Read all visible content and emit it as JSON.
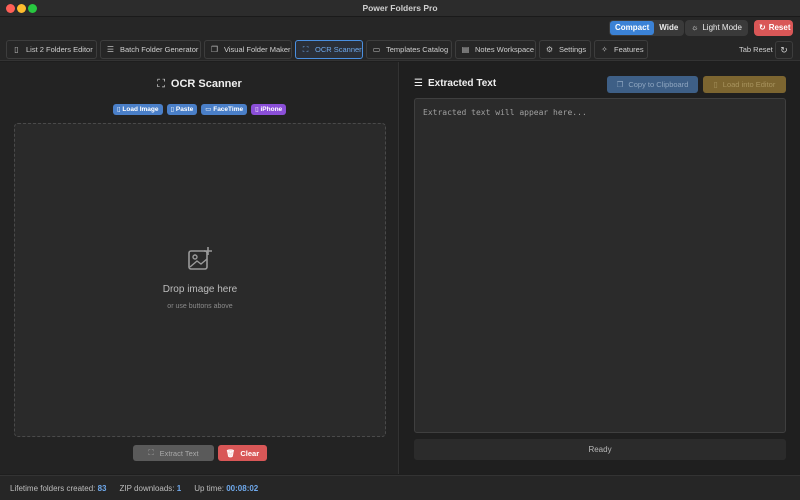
{
  "window": {
    "title": "Power Folders Pro"
  },
  "toolbar": {
    "compact_label": "Compact",
    "wide_label": "Wide",
    "light_mode_label": "Light Mode",
    "reset_label": "Reset"
  },
  "tabs": [
    {
      "label": "List 2 Folders Editor",
      "icon": "clipboard-icon"
    },
    {
      "label": "Batch Folder Generator",
      "icon": "list-icon"
    },
    {
      "label": "Visual Folder Maker",
      "icon": "image-stack-icon"
    },
    {
      "label": "OCR Scanner",
      "icon": "scan-icon",
      "active": true
    },
    {
      "label": "Templates Catalog",
      "icon": "folder-icon"
    },
    {
      "label": "Notes Workspace",
      "icon": "note-icon"
    },
    {
      "label": "Settings",
      "icon": "gear-icon"
    },
    {
      "label": "Features",
      "icon": "sparkles-icon"
    }
  ],
  "tab_reset_label": "Tab Reset",
  "ocr": {
    "title": "OCR Scanner",
    "chips": [
      "Load Image",
      "Paste",
      "FaceTime",
      "iPhone"
    ],
    "drop_main": "Drop image here",
    "drop_sub": "or use buttons above",
    "extract_label": "Extract Text",
    "clear_label": "Clear"
  },
  "extracted": {
    "title": "Extracted Text",
    "copy_label": "Copy to Clipboard",
    "load_label": "Load into Editor",
    "placeholder": "Extracted text will appear here...",
    "status": "Ready"
  },
  "footer": {
    "folders_label": "Lifetime folders created:",
    "folders_value": "83",
    "zip_label": "ZIP downloads:",
    "zip_value": "1",
    "uptime_label": "Up time:",
    "uptime_value": "00:08:02"
  },
  "colors": {
    "accent": "#3b82d6",
    "danger": "#d95757",
    "purple": "#8b4fd8"
  }
}
